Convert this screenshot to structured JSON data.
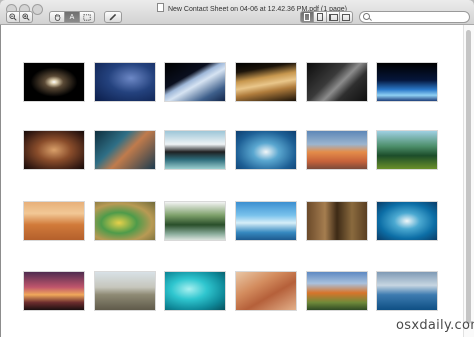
{
  "window": {
    "title": "New Contact Sheet on 04-06 at 12.42.36 PM.pdf (1 page)"
  },
  "toolbar": {
    "zoom_out_icon": "zoom-out-icon",
    "zoom_in_icon": "zoom-in-icon",
    "hand_icon": "hand-icon",
    "text_select_label": "A",
    "marquee_icon": "marquee-icon",
    "annotate_icon": "pencil-icon",
    "view_modes": [
      "single-page-icon",
      "continuous-icon",
      "two-page-icon",
      "sidebar-icon"
    ]
  },
  "search": {
    "placeholder": ""
  },
  "watermark": "osxdaily.com",
  "thumbnails": [
    {
      "bg": "radial-gradient(ellipse at 50% 50%, #fff 0%, #d8c9a8 8%, #5b4a36 22%, #000 55%)"
    },
    {
      "bg": "radial-gradient(ellipse at 60% 40%, #6d88c6 0%, #24427e 45%, #0b1d4a 100%)"
    },
    {
      "bg": "linear-gradient(150deg, #000 0%, #0a0f1f 35%, #9fb8d9 45%, #d6e3f2 55%, #3e5f8b 80%, #14264a 100%)"
    },
    {
      "bg": "linear-gradient(170deg, #000 0%, #1c140a 20%, #c7974e 40%, #e9c68a 55%, #b07c3c 70%, #1a1208 100%)"
    },
    {
      "bg": "linear-gradient(135deg, #0d0d0d 0%, #3a3a3a 40%, #8c8c8c 55%, #2e2e2e 70%, #0f0f0f 100%)"
    },
    {
      "bg": "linear-gradient(180deg, #000 0%, #05163b 45%, #2a79c9 70%, #8fd0f3 85%, #1e3f7c 100%)"
    },
    {
      "bg": "radial-gradient(ellipse at 50% 50%, #d9a06a 0%, #8a4d2b 40%, #3a1d14 80%, #150a08 100%)"
    },
    {
      "bg": "linear-gradient(135deg, #0f2f3e 0%, #2f6f86 35%, #c07b4c 55%, #1c3b4f 100%)"
    },
    {
      "bg": "linear-gradient(180deg, #9dc6d8 0%, #eef3f5 35%, #1f2022 55%, #2d6b7a 75%, #9ccfcf 100%)"
    },
    {
      "bg": "radial-gradient(ellipse at 50% 55%, #f2f6f8 0%, #5aa7d0 30%, #1d5f95 70%, #0d3e6f 100%)"
    },
    {
      "bg": "linear-gradient(180deg, #5d87b7 0%, #9bb5cf 35%, #e48d4a 55%, #c6623a 80%, #7a4a3a 100%)"
    },
    {
      "bg": "linear-gradient(180deg, #9fd0e3 0%, #4d8f6b 40%, #1c4d2a 65%, #6a8f2a 100%)"
    },
    {
      "bg": "linear-gradient(180deg, #e7b07a 0%, #f2c896 30%, #d17a3a 60%, #b4602c 100%)"
    },
    {
      "bg": "radial-gradient(ellipse at 40% 55%, #e6d14a 0%, #4e9b4a 35%, #b89a54 65%, #6f6a3a 100%)"
    },
    {
      "bg": "linear-gradient(180deg, #f3f3f3 0%, #7da06a 35%, #2a4f2a 60%, #8fb0a0 85%, #d9e2dc 100%)"
    },
    {
      "bg": "linear-gradient(180deg, #3b8fd0 0%, #79c2ec 35%, #d6eef8 55%, #3689c0 80%, #1d5a8f 100%)"
    },
    {
      "bg": "linear-gradient(90deg, #6b4a2a 0%, #a57d4f 30%, #3d2a16 50%, #8a6a3e 75%, #5a3f22 100%)"
    },
    {
      "bg": "radial-gradient(ellipse at 50% 50%, #f1f7f9 0%, #4ba9d1 30%, #0c6ea6 65%, #0a3c67 100%)"
    },
    {
      "bg": "linear-gradient(180deg, #4f2c4f 0%, #c0566c 40%, #f0a85a 60%, #6d2d2f 80%, #1b0f10 100%)"
    },
    {
      "bg": "linear-gradient(180deg, #d8e1e6 0%, #c6c6bc 40%, #8e8a74 60%, #5f5a4a 100%)"
    },
    {
      "bg": "radial-gradient(ellipse at 40% 45%, #a8f0f0 0%, #2fc6cf 35%, #0f8a9a 70%, #06515e 100%)"
    },
    {
      "bg": "linear-gradient(150deg, #e9c7a6 0%, #d38c5e 35%, #b5603a 60%, #e3b08a 100%)"
    },
    {
      "bg": "linear-gradient(180deg, #5e89c2 0%, #a9c1dd 30%, #d7742a 55%, #6f8a3a 80%, #2f4a24 100%)"
    },
    {
      "bg": "linear-gradient(180deg, #7f9ab5 0%, #c7d6e2 35%, #3d7bb0 60%, #0e4f84 100%)"
    }
  ]
}
